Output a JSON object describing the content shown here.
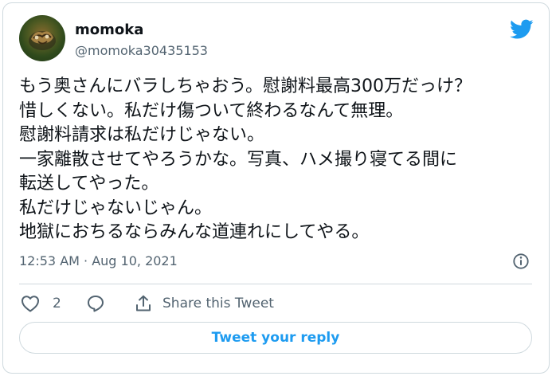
{
  "author": {
    "display_name": "momoka",
    "handle": "@momoka30435153"
  },
  "tweet": {
    "lines": [
      "もう奥さんにバラしちゃおう。慰謝料最高300万だっけ？",
      "惜しくない。私だけ傷ついて終わるなんて無理。",
      "慰謝料請求は私だけじゃない。",
      "一家離散させてやろうかな。写真、ハメ撮り寝てる間に",
      "転送してやった。",
      "私だけじゃないじゃん。",
      "地獄におちるならみんな道連れにしてやる。"
    ],
    "timestamp": "12:53 AM · Aug 10, 2021"
  },
  "actions": {
    "like_count": "2",
    "share_label": "Share this Tweet"
  },
  "reply_button": {
    "label": "Tweet your reply"
  },
  "icons": {
    "brand": "twitter-bird-icon",
    "like": "heart-icon",
    "reply": "comment-bubble-icon",
    "share": "share-icon",
    "info": "info-icon"
  },
  "colors": {
    "accent": "#1d9bf0",
    "text_primary": "#0f1419",
    "text_secondary": "#536471",
    "border": "#cfd9de"
  }
}
